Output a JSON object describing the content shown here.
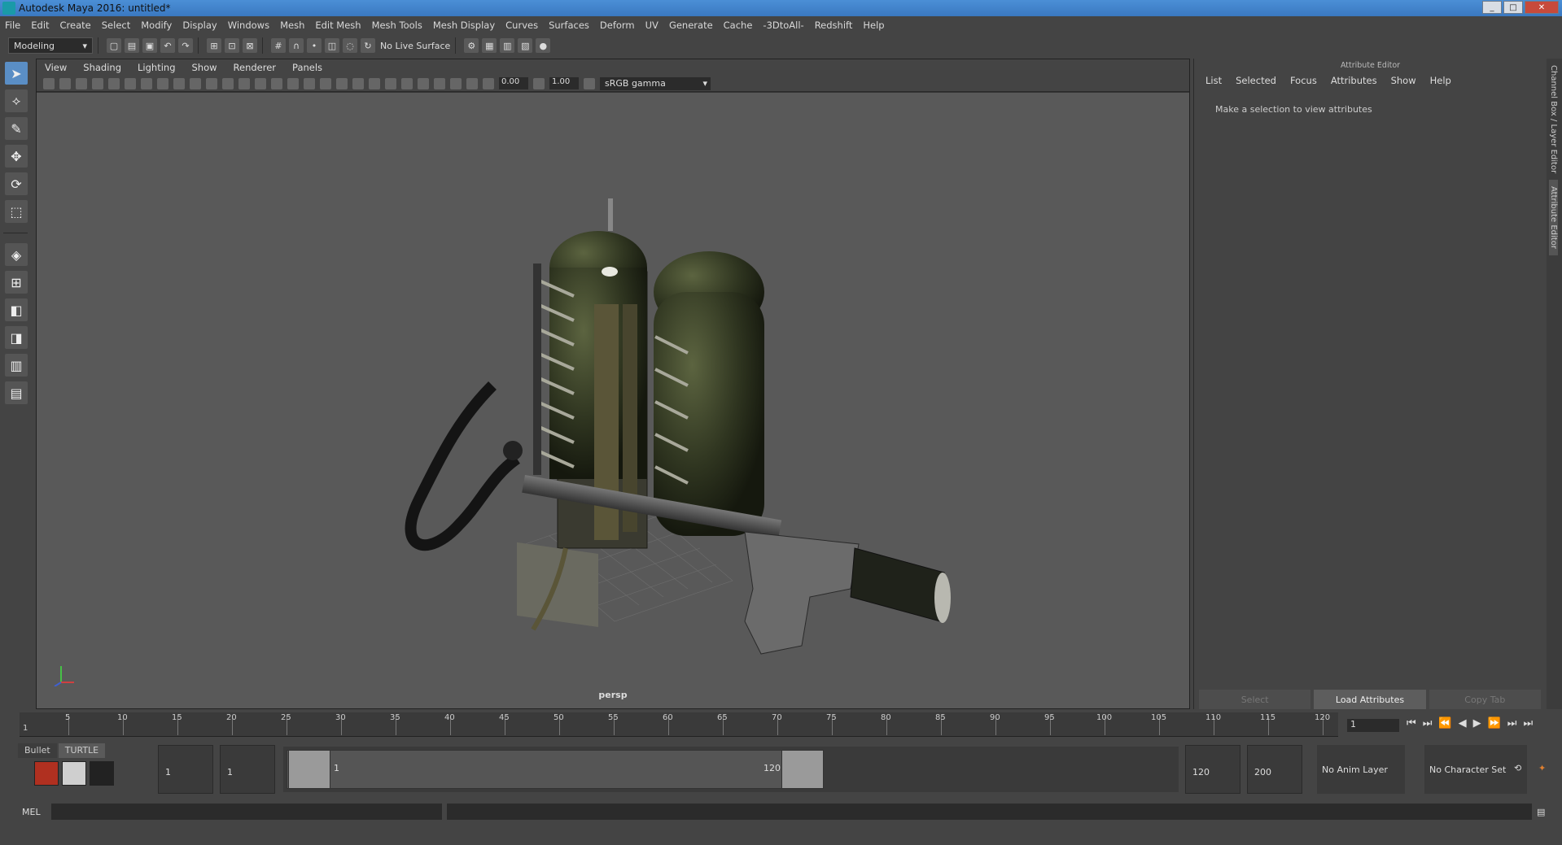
{
  "window": {
    "title": "Autodesk Maya 2016: untitled*"
  },
  "menubar": [
    "File",
    "Edit",
    "Create",
    "Select",
    "Modify",
    "Display",
    "Windows",
    "Mesh",
    "Edit Mesh",
    "Mesh Tools",
    "Mesh Display",
    "Curves",
    "Surfaces",
    "Deform",
    "UV",
    "Generate",
    "Cache",
    "-3DtoAll-",
    "Redshift",
    "Help"
  ],
  "toolbar": {
    "mode": "Modeling",
    "live_surface": "No Live Surface"
  },
  "viewport": {
    "menus": [
      "View",
      "Shading",
      "Lighting",
      "Show",
      "Renderer",
      "Panels"
    ],
    "exposure": "0.00",
    "gamma_value": "1.00",
    "color_space": "sRGB gamma",
    "camera_label": "persp"
  },
  "attribute_editor": {
    "header": "Attribute Editor",
    "menus": [
      "List",
      "Selected",
      "Focus",
      "Attributes",
      "Show",
      "Help"
    ],
    "message": "Make a selection to view attributes",
    "buttons": {
      "select": "Select",
      "load": "Load Attributes",
      "copy": "Copy Tab"
    }
  },
  "side_tabs": {
    "channel_box": "Channel Box / Layer Editor",
    "attribute_editor": "Attribute Editor"
  },
  "timeline": {
    "ticks": [
      "5",
      "10",
      "15",
      "20",
      "25",
      "30",
      "35",
      "40",
      "45",
      "50",
      "55",
      "60",
      "65",
      "70",
      "75",
      "80",
      "85",
      "90",
      "95",
      "100",
      "105",
      "110",
      "115",
      "120"
    ],
    "start_tick": "1",
    "current_frame": "1",
    "play_controls": [
      "⏮",
      "⏭",
      "⏪",
      "◀",
      "▶",
      "⏩",
      "⏭",
      "⏭"
    ]
  },
  "range": {
    "shelf_tabs": [
      "Bullet",
      "TURTLE"
    ],
    "start": "1",
    "playback_start": "1",
    "slider_start": "1",
    "slider_end": "120",
    "playback_end": "120",
    "end": "200",
    "anim_layer": "No Anim Layer",
    "character_set": "No Character Set"
  },
  "command_line": {
    "label": "MEL"
  }
}
